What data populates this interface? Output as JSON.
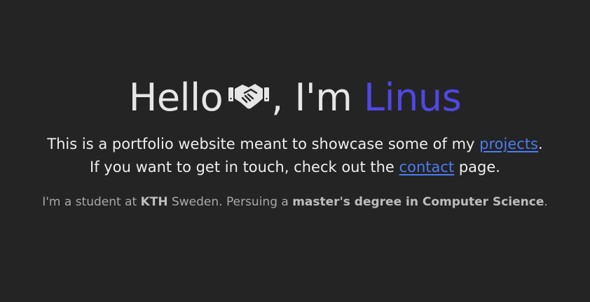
{
  "headline": {
    "greeting": "Hello",
    "icon": "handshake-icon",
    "separator": ", I'm",
    "name": "Linus",
    "name_color": "#5047e6"
  },
  "intro": {
    "line1_prefix": "This is a portfolio website meant to showcase some of my",
    "projects_link": "projects",
    "line1_suffix": ".",
    "line2_prefix": "If you want to get in touch, check out the",
    "contact_link": "contact",
    "line2_suffix": "page.",
    "link_color": "#4b7bf0"
  },
  "bio": {
    "prefix": "I'm a student at",
    "school": "KTH",
    "middle": "Sweden. Persuing a",
    "degree": "master's degree in Computer Science",
    "suffix": "."
  },
  "colors": {
    "background": "#242424",
    "text": "#e6e6e6",
    "muted": "#a9a9a9"
  }
}
